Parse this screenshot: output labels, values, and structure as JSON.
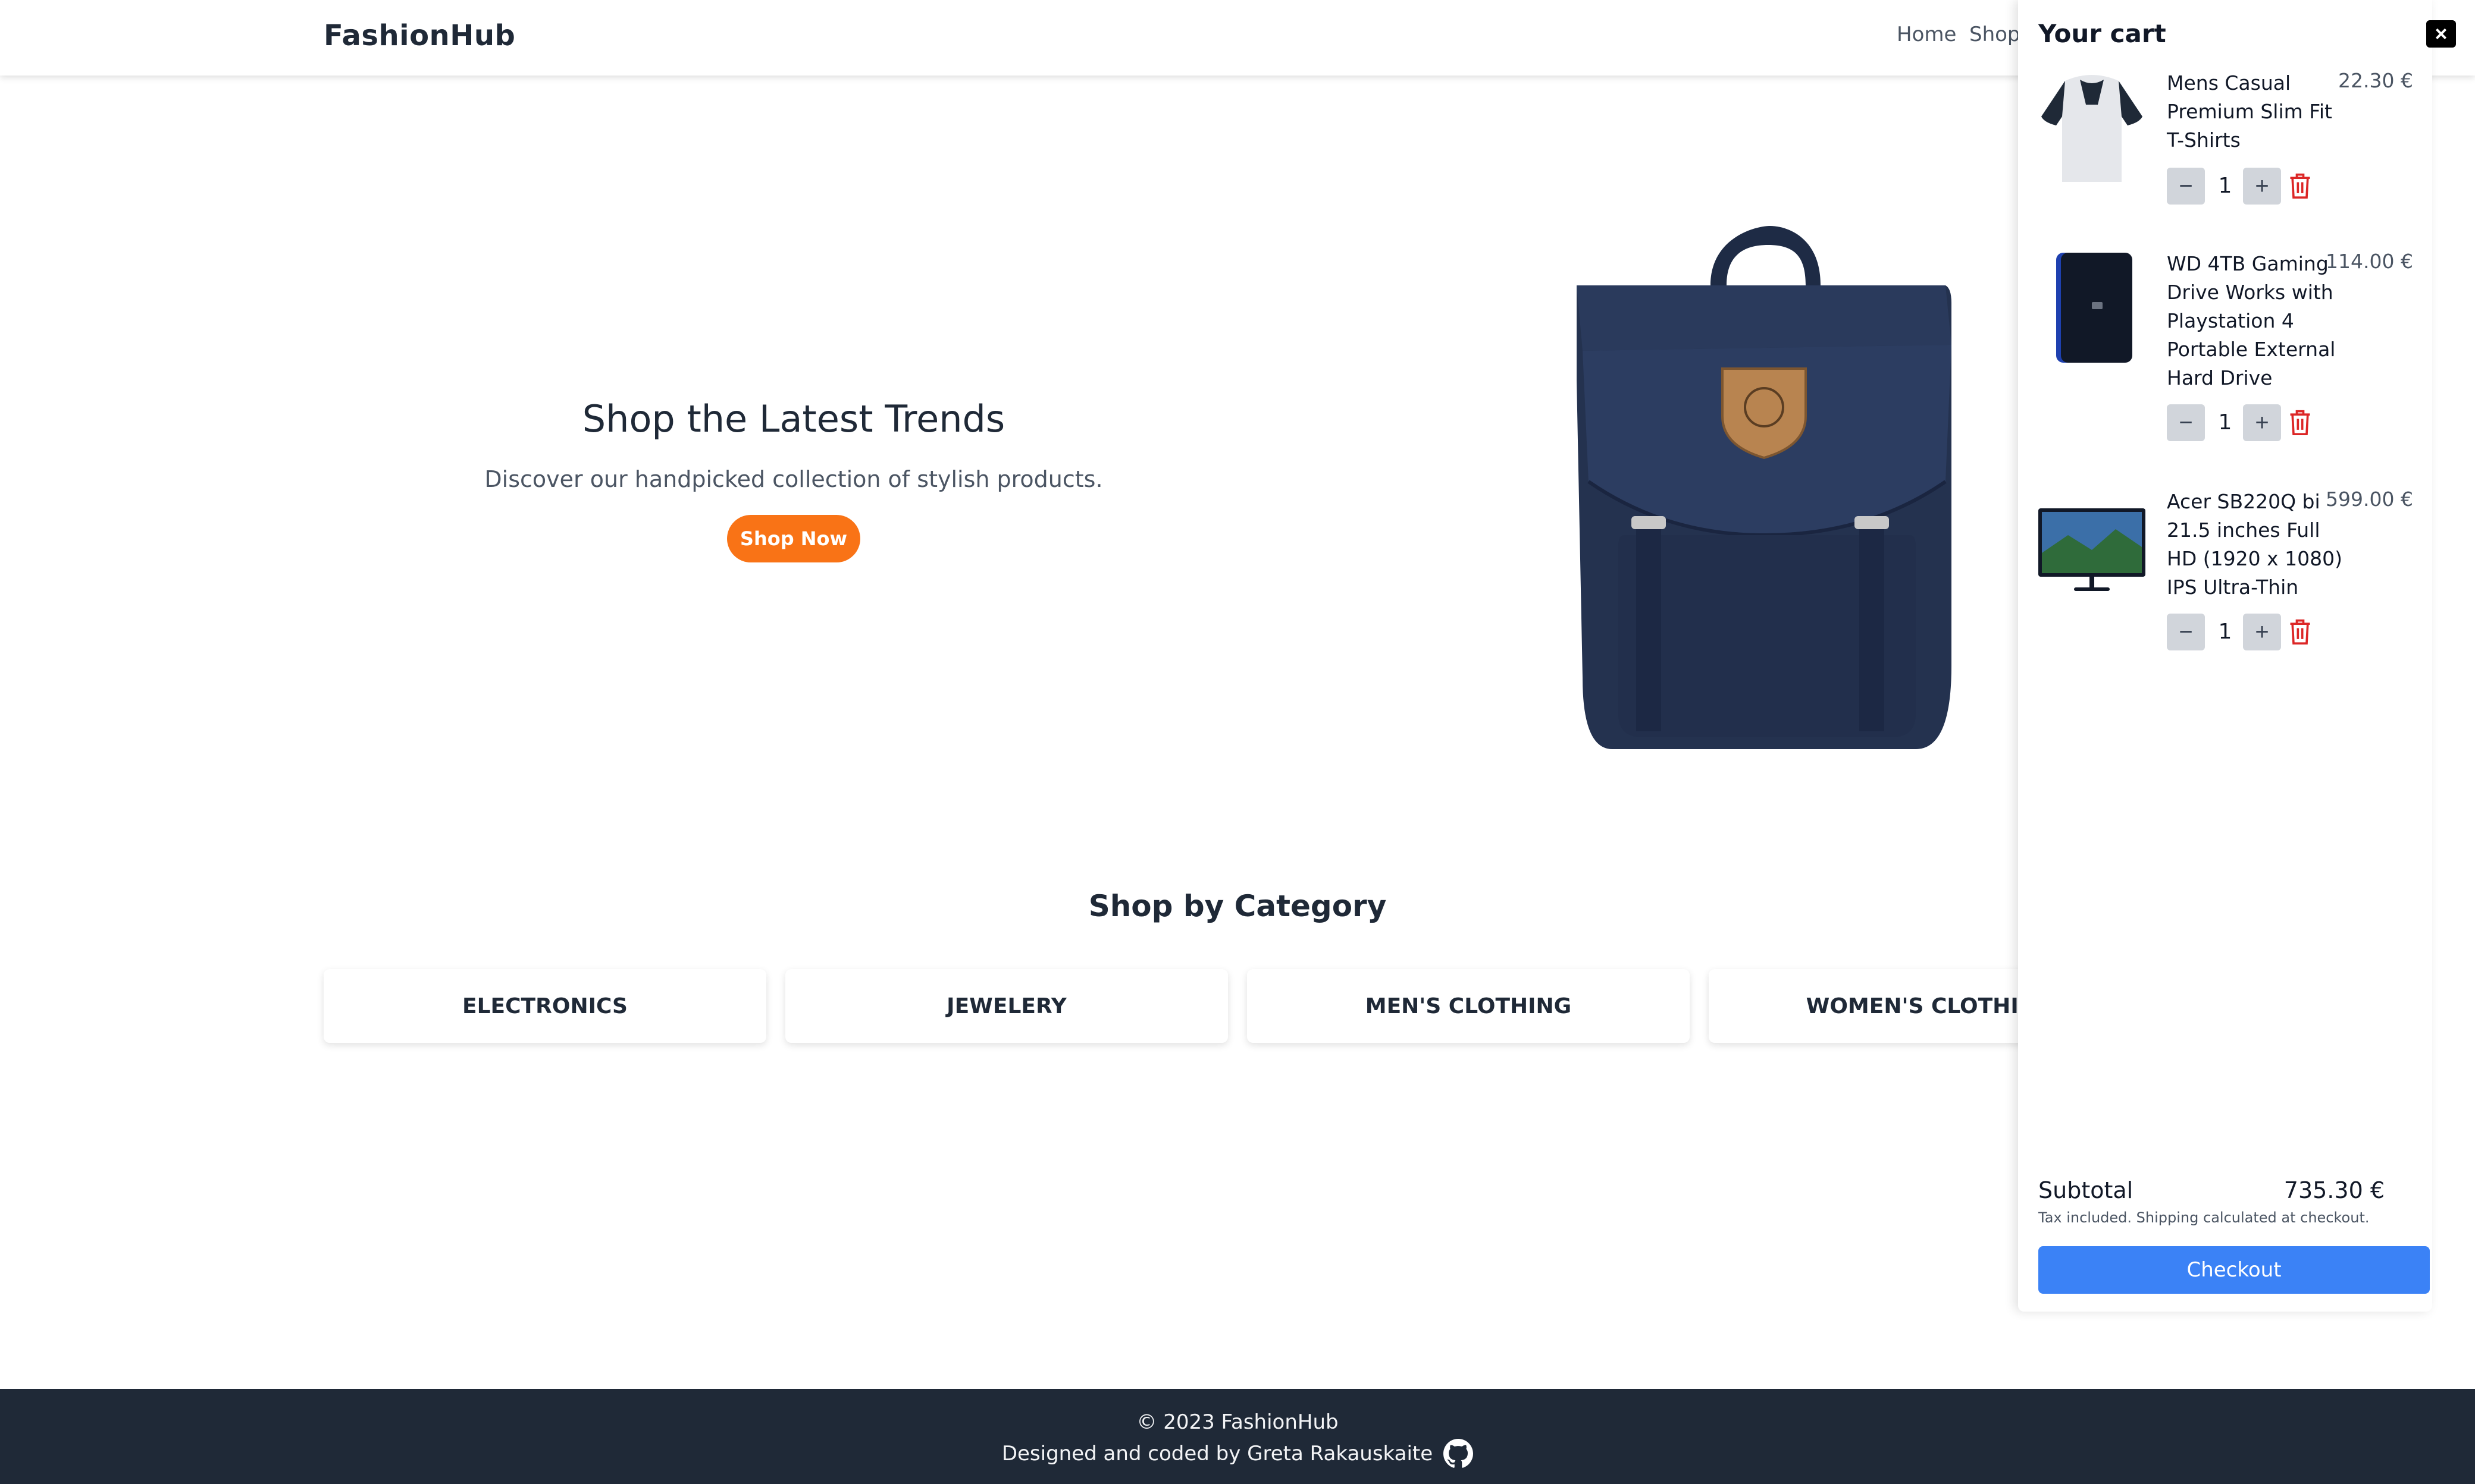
{
  "navbar": {
    "brand": "FashionHub",
    "links": [
      "Home",
      "Shop"
    ]
  },
  "hero": {
    "title": "Shop the Latest Trends",
    "subtitle": "Discover our handpicked collection of stylish products.",
    "cta": "Shop Now"
  },
  "categories": {
    "title": "Shop by Category",
    "items": [
      "ELECTRONICS",
      "JEWELERY",
      "MEN'S CLOTHING",
      "WOMEN'S CLOTHING"
    ]
  },
  "footer": {
    "copyright": "© 2023 FashionHub",
    "credit": "Designed and coded by Greta Rakauskaite"
  },
  "cart": {
    "title": "Your cart",
    "close_label": "×",
    "items": [
      {
        "name": "Mens Casual Premium Slim Fit T-Shirts",
        "price": "22.30 €",
        "qty": "1",
        "thumb": "t-shirt"
      },
      {
        "name": "WD 4TB Gaming Drive Works with Playstation 4 Portable External Hard Drive",
        "price": "114.00 €",
        "qty": "1",
        "thumb": "hard-drive"
      },
      {
        "name": "Acer SB220Q bi 21.5 inches Full HD (1920 x 1080) IPS Ultra-Thin",
        "price": "599.00 €",
        "qty": "1",
        "thumb": "monitor"
      }
    ],
    "subtotal_label": "Subtotal",
    "subtotal_value": "735.30 €",
    "tax_note": "Tax included. Shipping calculated at checkout.",
    "checkout_label": "Checkout"
  },
  "colors": {
    "accent_orange": "#f97316",
    "checkout_blue": "#3b82f6",
    "footer_bg": "#1f2937",
    "trash_red": "#dc2626"
  }
}
